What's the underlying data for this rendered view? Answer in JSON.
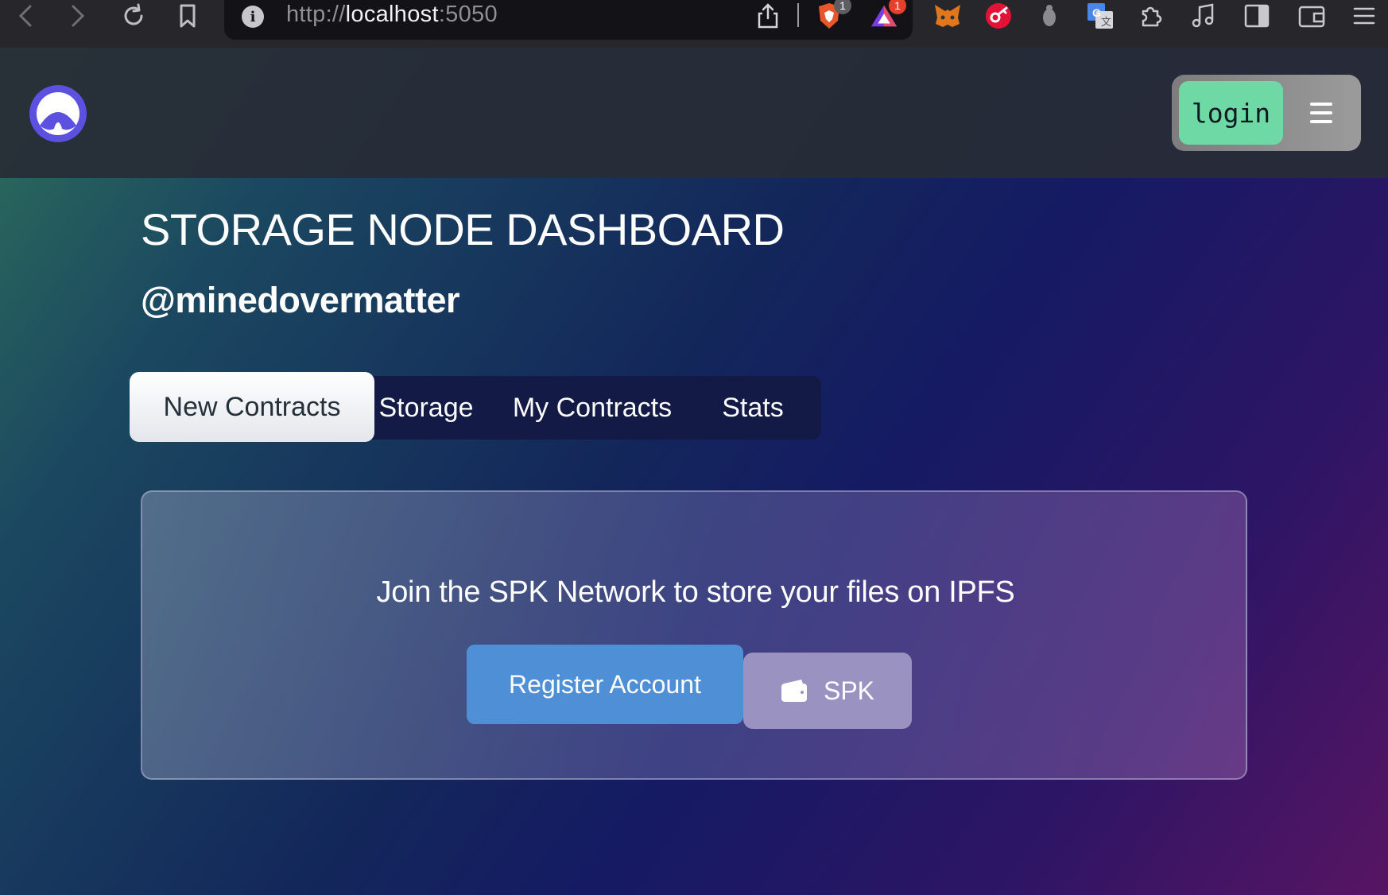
{
  "browser": {
    "url_scheme": "http://",
    "url_host": "localhost",
    "url_port": ":5050",
    "ext_badges": [
      "1",
      "1"
    ],
    "icons": [
      "back-icon",
      "forward-icon",
      "reload-icon",
      "bookmark-icon",
      "info-icon",
      "share-icon",
      "brave-shields-icon",
      "brave-rewards-icon",
      "metamask-icon",
      "keychain-icon",
      "bug-icon",
      "translate-icon",
      "extensions-icon",
      "media-icon",
      "sidebar-icon",
      "wallet-icon",
      "menu-icon"
    ]
  },
  "header": {
    "login_label": "login",
    "accent_login": "#6ed9a4"
  },
  "main": {
    "title": "STORAGE NODE DASHBOARD",
    "username": "@minedovermatter",
    "tabs": [
      {
        "label": "New Contracts",
        "active": true
      },
      {
        "label": "Storage",
        "active": false
      },
      {
        "label": "My Contracts",
        "active": false
      },
      {
        "label": "Stats",
        "active": false
      }
    ]
  },
  "card": {
    "message": "Join the SPK Network to store your files on IPFS",
    "register_label": "Register Account",
    "spk_label": "SPK",
    "accent_register": "#4f8fd6"
  }
}
